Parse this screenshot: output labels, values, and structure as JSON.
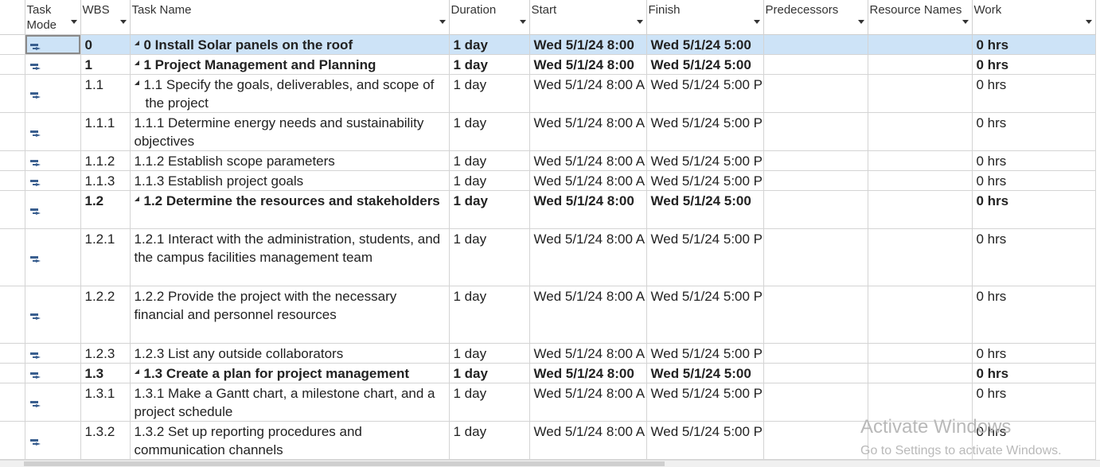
{
  "columns": {
    "task_mode": "Task Mode",
    "wbs": "WBS",
    "task_name": "Task Name",
    "duration": "Duration",
    "start": "Start",
    "finish": "Finish",
    "predecessors": "Predecessors",
    "resource_names": "Resource Names",
    "work": "Work"
  },
  "rows": [
    {
      "wbs": "0",
      "name": "0 Install Solar panels on the roof",
      "duration": "1 day",
      "start": "Wed 5/1/24 8:00",
      "finish": "Wed 5/1/24 5:00",
      "predecessors": "",
      "resources": "",
      "work": "0 hrs",
      "summary": true,
      "selected": true
    },
    {
      "wbs": "1",
      "name": "1 Project Management and Planning",
      "duration": "1 day",
      "start": "Wed 5/1/24 8:00",
      "finish": "Wed 5/1/24 5:00",
      "predecessors": "",
      "resources": "",
      "work": "0 hrs",
      "summary": true
    },
    {
      "wbs": "1.1",
      "name": "1.1 Specify the goals, deliverables, and scope of the project",
      "duration": "1 day",
      "start": "Wed 5/1/24 8:00 A",
      "finish": "Wed 5/1/24 5:00 P",
      "predecessors": "",
      "resources": "",
      "work": "0 hrs",
      "summary": false,
      "collapsible": true
    },
    {
      "wbs": "1.1.1",
      "name": "1.1.1 Determine energy needs and sustainability objectives",
      "duration": "1 day",
      "start": "Wed 5/1/24 8:00 A",
      "finish": "Wed 5/1/24 5:00 P",
      "predecessors": "",
      "resources": "",
      "work": "0 hrs",
      "summary": false
    },
    {
      "wbs": "1.1.2",
      "name": "1.1.2 Establish scope parameters",
      "duration": "1 day",
      "start": "Wed 5/1/24 8:00 A",
      "finish": "Wed 5/1/24 5:00 P",
      "predecessors": "",
      "resources": "",
      "work": "0 hrs",
      "summary": false
    },
    {
      "wbs": "1.1.3",
      "name": "1.1.3 Establish project goals",
      "duration": "1 day",
      "start": "Wed 5/1/24 8:00 A",
      "finish": "Wed 5/1/24 5:00 P",
      "predecessors": "",
      "resources": "",
      "work": "0 hrs",
      "summary": false
    },
    {
      "wbs": "1.2",
      "name": "1.2 Determine the resources and stakeholders",
      "duration": "1 day",
      "start": "Wed 5/1/24 8:00",
      "finish": "Wed 5/1/24 5:00",
      "predecessors": "",
      "resources": "",
      "work": "0 hrs",
      "summary": true
    },
    {
      "wbs": "1.2.1",
      "name": "1.2.1 Interact with the administration, students, and the campus facilities management team",
      "duration": "1 day",
      "start": "Wed 5/1/24 8:00 A",
      "finish": "Wed 5/1/24 5:00 P",
      "predecessors": "",
      "resources": "",
      "work": "0 hrs",
      "summary": false
    },
    {
      "wbs": "1.2.2",
      "name": "1.2.2 Provide the project with the necessary financial and personnel resources",
      "duration": "1 day",
      "start": "Wed 5/1/24 8:00 A",
      "finish": "Wed 5/1/24 5:00 P",
      "predecessors": "",
      "resources": "",
      "work": "0 hrs",
      "summary": false
    },
    {
      "wbs": "1.2.3",
      "name": "1.2.3 List any outside collaborators",
      "duration": "1 day",
      "start": "Wed 5/1/24 8:00 A",
      "finish": "Wed 5/1/24 5:00 P",
      "predecessors": "",
      "resources": "",
      "work": "0 hrs",
      "summary": false
    },
    {
      "wbs": "1.3",
      "name": "1.3 Create a plan for project management",
      "duration": "1 day",
      "start": "Wed 5/1/24 8:00",
      "finish": "Wed 5/1/24 5:00",
      "predecessors": "",
      "resources": "",
      "work": "0 hrs",
      "summary": true
    },
    {
      "wbs": "1.3.1",
      "name": "1.3.1 Make a Gantt chart, a milestone chart, and a project schedule",
      "duration": "1 day",
      "start": "Wed 5/1/24 8:00 A",
      "finish": "Wed 5/1/24 5:00 P",
      "predecessors": "",
      "resources": "",
      "work": "0 hrs",
      "summary": false
    },
    {
      "wbs": "1.3.2",
      "name": "1.3.2 Set up reporting procedures and communication channels",
      "duration": "1 day",
      "start": "Wed 5/1/24 8:00 A",
      "finish": "Wed 5/1/24 5:00 P",
      "predecessors": "",
      "resources": "",
      "work": "0 hrs",
      "summary": false
    }
  ],
  "watermark": {
    "title": "Activate Windows",
    "subtitle": "Go to Settings to activate Windows."
  },
  "colors": {
    "selected_row": "#cde3f7",
    "task_mode_icon": "#3a5f8f",
    "grid_lines": "#d4d4d4"
  },
  "icons": {
    "task_mode": "auto-scheduled-task-icon",
    "outline_toggle": "collapse-triangle-icon",
    "column_filter": "filter-dropdown-arrow-icon"
  }
}
